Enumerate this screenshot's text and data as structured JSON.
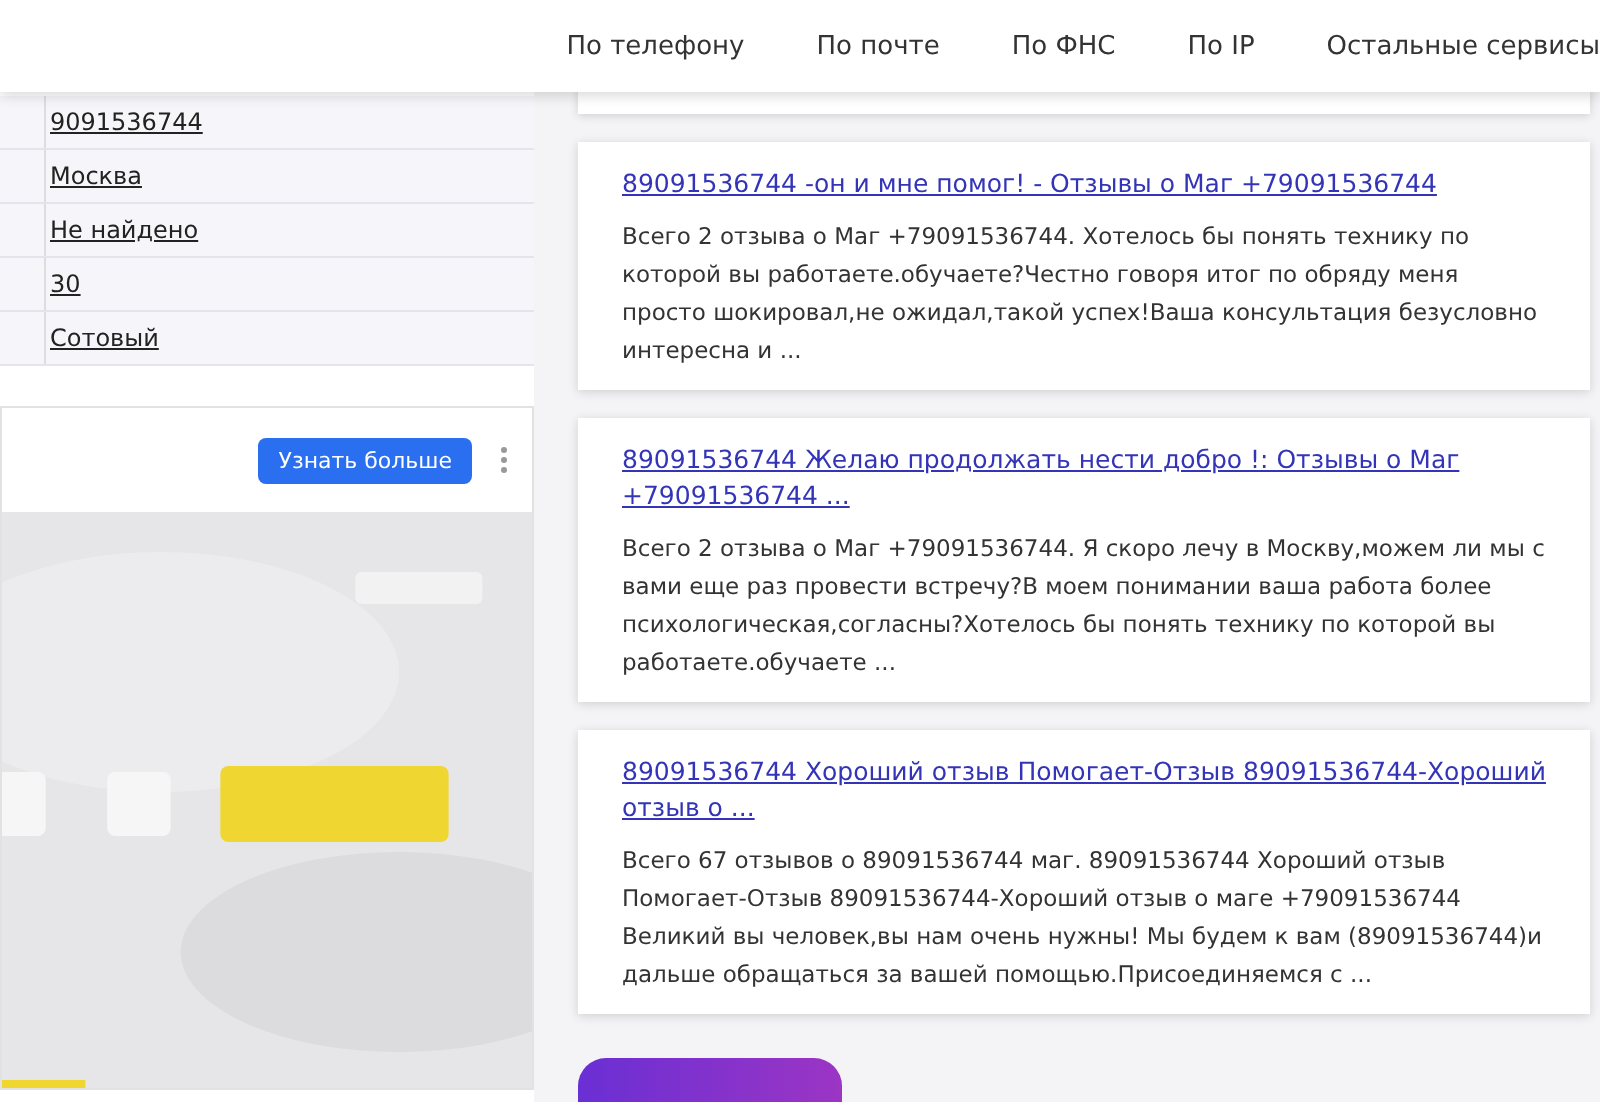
{
  "nav": [
    "По телефону",
    "По почте",
    "По ФНС",
    "По IP",
    "Остальные сервисы"
  ],
  "info_rows": [
    "9091536744",
    "Москва",
    "Не найдено",
    "30",
    "Сотовый"
  ],
  "ad": {
    "button": "Узнать больше",
    "kind": "picture"
  },
  "results": [
    {
      "title": "89091536744 -он и мне помог! - Отзывы о Маг +79091536744",
      "snippet": "Всего 2 отзыва о Маг +79091536744. Хотелось бы понять технику по которой вы работаете.обучаете?Честно говоря итог по обряду меня просто шокировал,не ожидал,такой успех!Ваша консультация безусловно интересна и ..."
    },
    {
      "title": "89091536744 Желаю продолжать нести добро !: Отзывы о Маг +79091536744 ...",
      "snippet": "Всего 2 отзыва о Маг +79091536744. Я скоро лечу в Москву,можем ли мы с вами еще раз провести встречу?В моем понимании ваша работа более психологическая,согласны?Хотелось бы понять технику по которой вы работаете.обучаете ..."
    },
    {
      "title": "89091536744 Хороший отзыв Помогает-Отзыв 89091536744-Хороший отзыв о ...",
      "snippet": "Всего 67 отзывов о 89091536744 маг. 89091536744 Хороший отзыв Помогает-Отзыв 89091536744-Хороший отзыв о маге +79091536744 Великий вы человек,вы нам очень нужны! Мы будем к вам (89091536744)и дальше обращаться за вашей помощью.Присоединяемся с ..."
    }
  ]
}
